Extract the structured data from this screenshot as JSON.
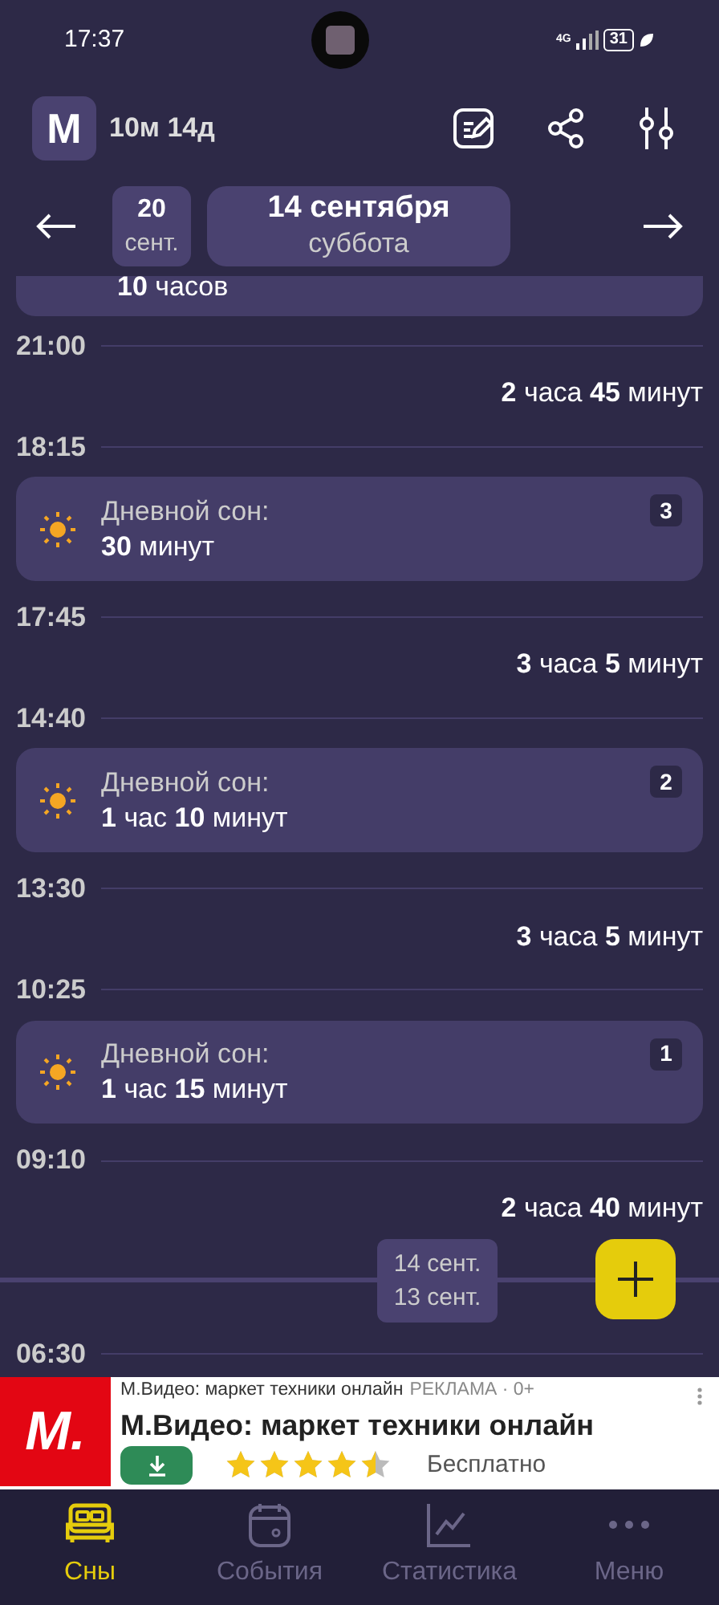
{
  "status_bar": {
    "time": "17:37",
    "network": "4G",
    "battery": "31"
  },
  "header": {
    "avatar_letter": "М",
    "age": "10м 14д"
  },
  "date_nav": {
    "short_date": "20",
    "short_month": "сент.",
    "date": "14 сентября",
    "weekday": "суббота"
  },
  "timeline": [
    {
      "kind": "partial",
      "text": "**10** часов"
    },
    {
      "kind": "time",
      "text": "21:00"
    },
    {
      "kind": "duration",
      "text": "**2** часа **45** минут"
    },
    {
      "kind": "time",
      "text": "18:15"
    },
    {
      "kind": "nap",
      "label": "Дневной сон:",
      "text": "**30** минут",
      "count": "3"
    },
    {
      "kind": "time",
      "text": "17:45"
    },
    {
      "kind": "duration",
      "text": "**3** часа **5** минут"
    },
    {
      "kind": "time",
      "text": "14:40"
    },
    {
      "kind": "nap",
      "label": "Дневной сон:",
      "text": "**1** час **10** минут",
      "count": "2"
    },
    {
      "kind": "time",
      "text": "13:30"
    },
    {
      "kind": "duration",
      "text": "**3** часа **5** минут"
    },
    {
      "kind": "time",
      "text": "10:25"
    },
    {
      "kind": "nap",
      "label": "Дневной сон:",
      "text": "**1** час **15** минут",
      "count": "1"
    },
    {
      "kind": "time",
      "text": "09:10"
    },
    {
      "kind": "duration",
      "text": "**2** часа **40** минут"
    },
    {
      "kind": "separator",
      "upper": "14 сент.",
      "lower": "13 сент."
    },
    {
      "kind": "time",
      "text": "06:30"
    }
  ],
  "ad": {
    "logo": "М.",
    "source": "М.Видео: маркет техники онлайн",
    "tag": "РЕКЛАМА · 0+",
    "title": "М.Видео: маркет техники онлайн",
    "stars": 4.5,
    "price": "Бесплатно"
  },
  "bottom_nav": [
    {
      "label": "Сны",
      "selected": true
    },
    {
      "label": "События",
      "selected": false
    },
    {
      "label": "Статистика",
      "selected": false
    },
    {
      "label": "Меню",
      "selected": false
    }
  ]
}
